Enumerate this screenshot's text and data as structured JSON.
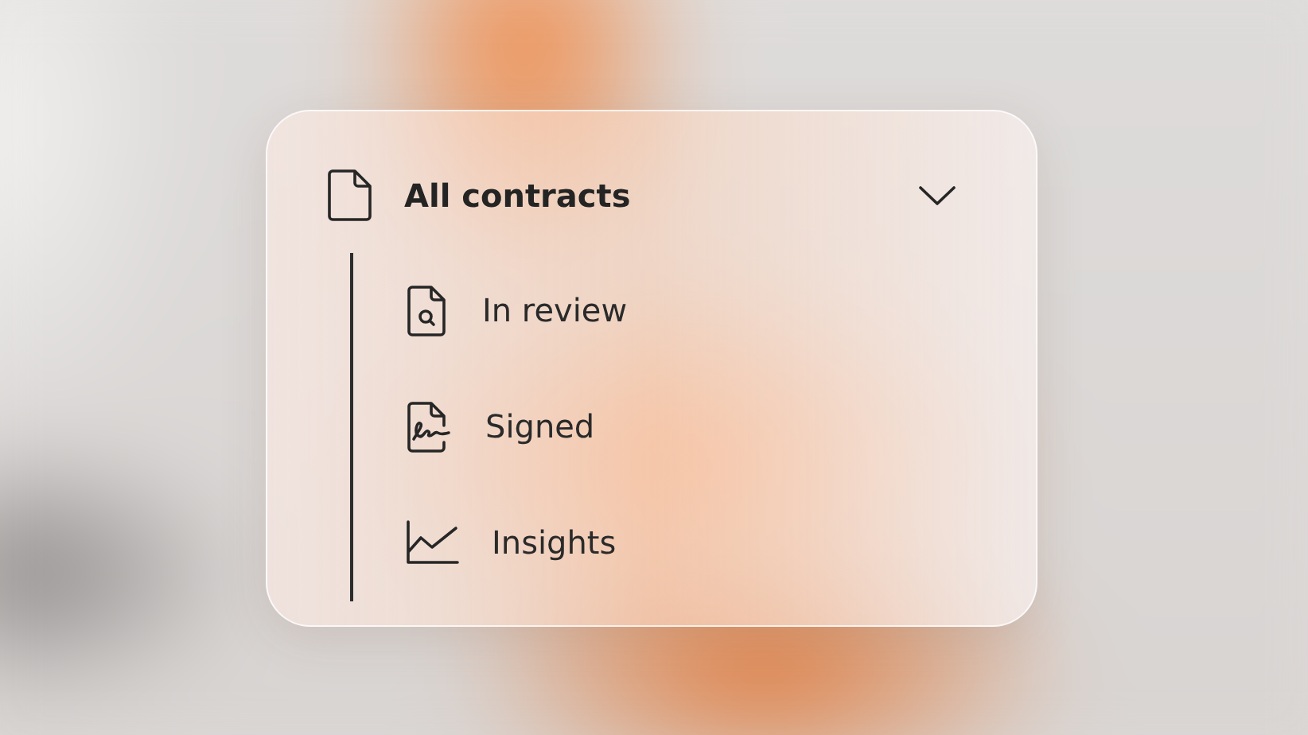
{
  "menu": {
    "title": "All contracts",
    "expanded": true,
    "items": [
      {
        "label": "In review",
        "kind": "review"
      },
      {
        "label": "Signed",
        "kind": "signed"
      },
      {
        "label": "Insights",
        "kind": "chart"
      }
    ]
  }
}
